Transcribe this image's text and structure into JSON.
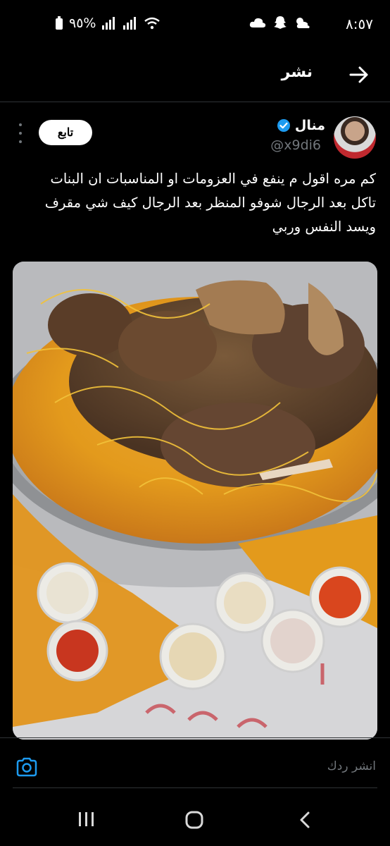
{
  "status_bar": {
    "time": "٨:٥٧",
    "battery": "%٩٥"
  },
  "header": {
    "title": "نشر"
  },
  "tweet": {
    "display_name": "منال",
    "handle": "@x9di6",
    "follow_label": "تابع",
    "text": "كم مره اقول م ينفع في العزومات  او المناسبات ان البنات\nتاكل بعد الرجال شوفو المنظر بعد الرجال كيف شي مقرف\nويسد النفس وربي",
    "verified": true
  },
  "reply_bar": {
    "placeholder": "انشر ردك"
  },
  "colors": {
    "background": "#000000",
    "text_primary": "#e7e9ea",
    "text_secondary": "#71767b",
    "verified_blue": "#1d9bf0",
    "border": "#2f3336"
  },
  "icons": [
    "back-arrow-icon",
    "verified-badge-icon",
    "more-options-icon",
    "camera-icon",
    "nav-recents-icon",
    "nav-home-icon",
    "nav-back-icon"
  ]
}
